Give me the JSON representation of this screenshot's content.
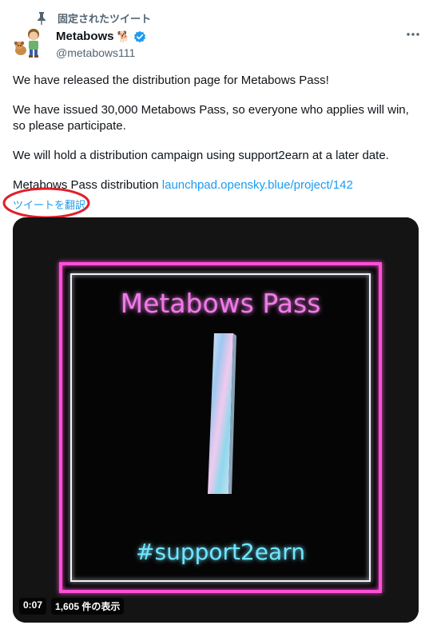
{
  "pinned": {
    "label": "固定されたツイート",
    "icon": "pin-icon"
  },
  "author": {
    "name": "Metabows",
    "emoji": "🐕",
    "handle": "@metabows111",
    "verified": true
  },
  "tweet": {
    "paragraphs": [
      "We have released the distribution page for Metabows Pass!",
      "We have issued 30,000 Metabows Pass, so everyone who applies will win, so please participate.",
      "We will hold a distribution campaign using support2earn at a later date."
    ],
    "link_prefix": "Metabows Pass distribution ",
    "link_text": "launchpad.opensky.blue/project/142",
    "translate_label": "ツイートを翻訳"
  },
  "media": {
    "title": "Metabows Pass",
    "hashtag": "#support2earn",
    "duration": "0:07",
    "views": "1,605 件の表示"
  },
  "colors": {
    "accent": "#1d9bf0",
    "annotation": "#e0202a",
    "neon_pink": "#ff4fd8",
    "neon_cyan": "#6fe6ff"
  }
}
